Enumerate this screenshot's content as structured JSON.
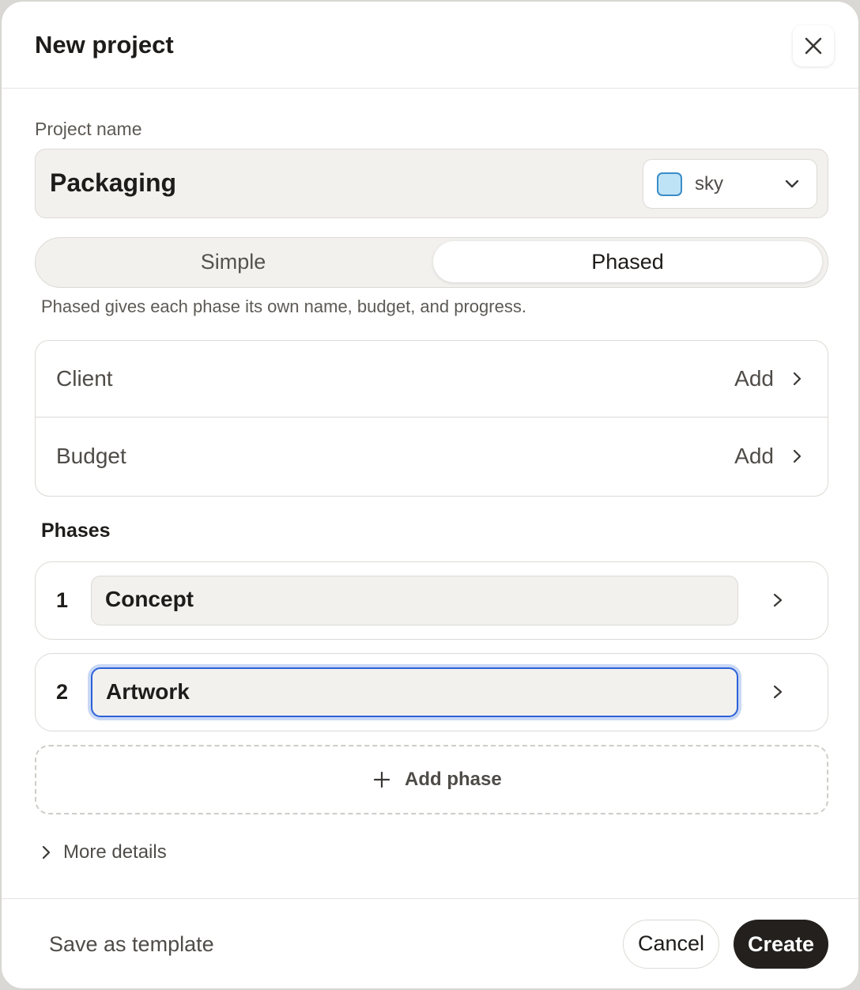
{
  "header": {
    "title": "New project",
    "close_icon": "close-icon"
  },
  "project": {
    "name_label": "Project name",
    "name_value": "Packaging",
    "color": {
      "selected_label": "sky",
      "swatch_fill": "#bfe3f6",
      "swatch_border": "#3a8cc6"
    }
  },
  "mode_toggle": {
    "options": [
      "Simple",
      "Phased"
    ],
    "selected": "Phased",
    "hint": "Phased gives each phase its own name, budget, and progress."
  },
  "details": {
    "rows": [
      {
        "label": "Client",
        "action": "Add"
      },
      {
        "label": "Budget",
        "action": "Add"
      }
    ]
  },
  "phases": {
    "title": "Phases",
    "items": [
      {
        "number": "1",
        "name": "Concept",
        "focused": false
      },
      {
        "number": "2",
        "name": "Artwork",
        "focused": true
      }
    ],
    "add_label": "Add phase"
  },
  "more_details": {
    "label": "More details"
  },
  "footer": {
    "save_template_label": "Save as template",
    "cancel_label": "Cancel",
    "create_label": "Create"
  },
  "colors": {
    "accent_focus": "#2c62d8",
    "primary_button": "#23201d",
    "field_background": "#f2f1ee"
  }
}
